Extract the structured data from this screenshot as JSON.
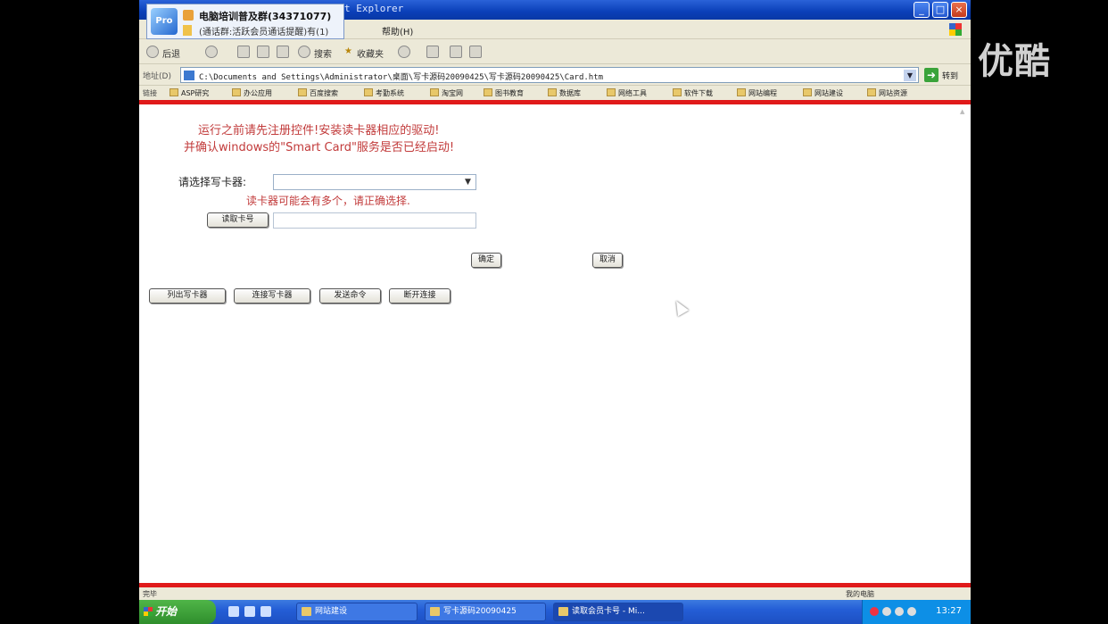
{
  "watermark": "优酷",
  "window": {
    "title": "t Explorer",
    "minimize": "_",
    "maximize": "□",
    "close": "×"
  },
  "notification": {
    "logo_text": "Pro",
    "title": "电脑培训普及群(34371077)",
    "message": "(通话群:活跃会员通话提醒)有(1)"
  },
  "menu": {
    "items": [
      "帮助(H)"
    ]
  },
  "toolbar": {
    "back": "后退",
    "search": "搜索",
    "favorites": "收藏夹"
  },
  "address": {
    "label": "地址(D)",
    "url": "C:\\Documents and Settings\\Administrator\\桌面\\写卡源码20090425\\写卡源码20090425\\Card.htm",
    "go_label": "转到"
  },
  "links": {
    "label": "链接",
    "items": [
      "ASP研究",
      "办公应用",
      "百度搜索",
      "考勤系统",
      "淘宝网",
      "图书教育",
      "数据库",
      "网络工具",
      "软件下载",
      "网站编程",
      "网站建设",
      "网站资源"
    ]
  },
  "content": {
    "notice_line1": "运行之前请先注册控件!安装读卡器相应的驱动!",
    "notice_line2": "并确认windows的\"Smart Card\"服务是否已经启动!",
    "reader_label": "请选择写卡器:",
    "reader_selected": "",
    "reader_hint": "读卡器可能会有多个，请正确选择.",
    "read_card_button": "读取卡号",
    "card_number_value": "",
    "confirm_button": "确定",
    "cancel_button": "取消",
    "bottom_buttons": [
      "列出写卡器",
      "连接写卡器",
      "发送命令",
      "断开连接"
    ]
  },
  "status": {
    "left": "完毕",
    "right": "我的电脑"
  },
  "taskbar": {
    "start": "开始",
    "tasks": [
      "网站建设",
      "写卡源码20090425",
      "读取会员卡号 - Mi..."
    ],
    "time": "13:27"
  }
}
